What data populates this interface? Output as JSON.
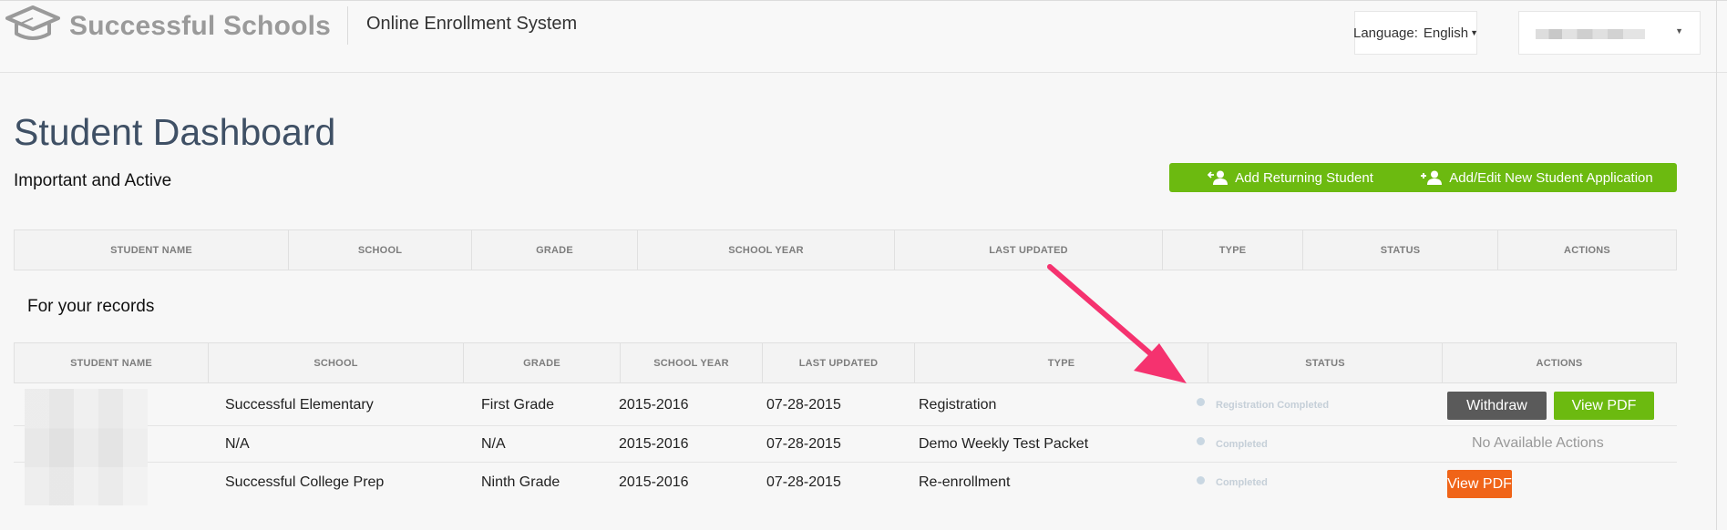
{
  "header": {
    "brand": "Successful Schools",
    "system_title": "Online Enrollment System",
    "language_label": "Language:",
    "language_value": "English"
  },
  "page": {
    "title": "Student Dashboard",
    "important_heading": "Important and Active",
    "records_heading": "For your records",
    "add_returning_label": "Add Returning Student",
    "add_new_label": "Add/Edit New Student Application"
  },
  "important_table": {
    "columns": [
      "STUDENT NAME",
      "SCHOOL",
      "GRADE",
      "SCHOOL YEAR",
      "LAST UPDATED",
      "TYPE",
      "STATUS",
      "ACTIONS"
    ]
  },
  "records_table": {
    "columns": [
      "STUDENT NAME",
      "SCHOOL",
      "GRADE",
      "SCHOOL YEAR",
      "LAST UPDATED",
      "TYPE",
      "STATUS",
      "ACTIONS"
    ],
    "rows": [
      {
        "school": "Successful Elementary",
        "grade": "First Grade",
        "school_year": "2015-2016",
        "last_updated": "07-28-2015",
        "type": "Registration",
        "status": "Registration Completed",
        "actions": {
          "withdraw": "Withdraw",
          "view_pdf": "View PDF"
        }
      },
      {
        "school": "N/A",
        "grade": "N/A",
        "school_year": "2015-2016",
        "last_updated": "07-28-2015",
        "type": "Demo Weekly Test Packet",
        "status": "Completed",
        "actions": {
          "none": "No Available Actions"
        }
      },
      {
        "school": "Successful College Prep",
        "grade": "Ninth Grade",
        "school_year": "2015-2016",
        "last_updated": "07-28-2015",
        "type": "Re-enrollment",
        "status": "Completed",
        "actions": {
          "view_pdf": "View PDF"
        }
      }
    ]
  },
  "colors": {
    "accent_green": "#6cba10",
    "accent_orange": "#f06418",
    "withdraw_gray": "#5a5a5a",
    "title_blue": "#3f5065",
    "arrow_pink": "#f5326f"
  }
}
